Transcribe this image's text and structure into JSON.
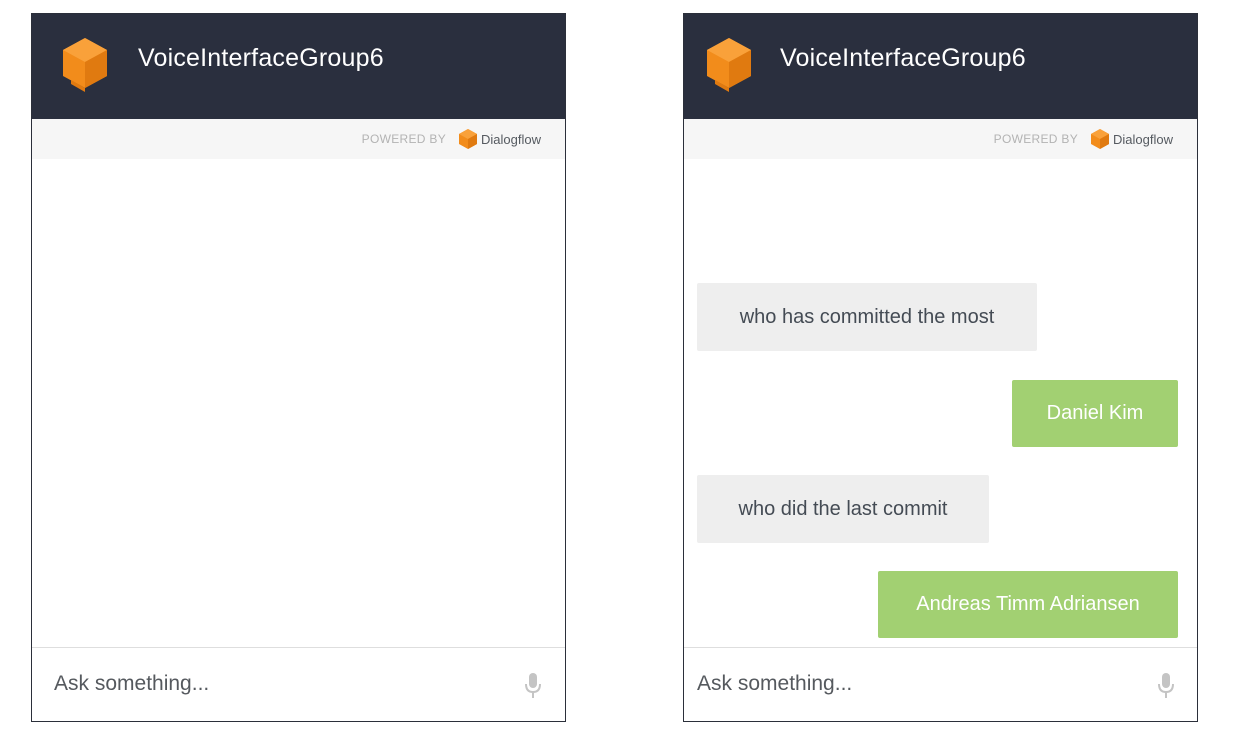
{
  "colors": {
    "header_bg": "#2a2f3e",
    "logo_orange": "#f28c1b",
    "bot_bubble": "#a2d072",
    "user_bubble": "#eeeeee"
  },
  "panels": [
    {
      "header": {
        "title": "VoiceInterfaceGroup6",
        "logo_icon": "dialogflow-logo-icon"
      },
      "powered_by": {
        "label": "POWERED BY",
        "brand": "Dialogflow"
      },
      "messages": [],
      "input": {
        "placeholder": "Ask something...",
        "mic_icon": "microphone-icon"
      }
    },
    {
      "header": {
        "title": "VoiceInterfaceGroup6",
        "logo_icon": "dialogflow-logo-icon"
      },
      "powered_by": {
        "label": "POWERED BY",
        "brand": "Dialogflow"
      },
      "messages": [
        {
          "sender": "user",
          "text": "who has committed the most"
        },
        {
          "sender": "bot",
          "text": "Daniel Kim"
        },
        {
          "sender": "user",
          "text": "who did the last commit"
        },
        {
          "sender": "bot",
          "text": "Andreas Timm Adriansen"
        }
      ],
      "input": {
        "placeholder": "Ask something...",
        "mic_icon": "microphone-icon"
      }
    }
  ]
}
